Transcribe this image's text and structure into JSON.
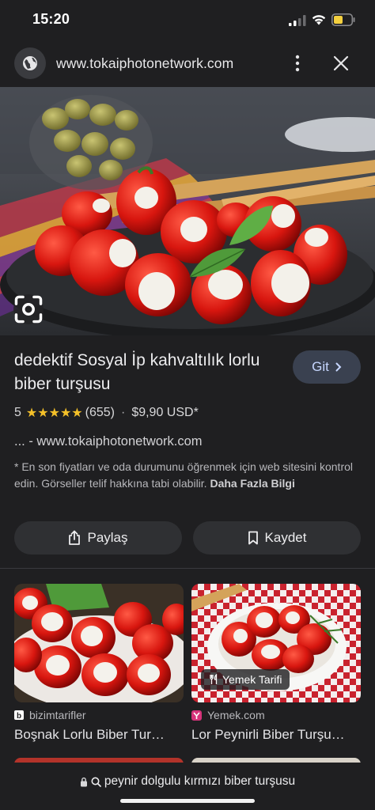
{
  "status_bar": {
    "time": "15:20"
  },
  "url_bar": {
    "url": "www.tokaiphotonetwork.com"
  },
  "product": {
    "title": "dedektif Sosyal İp kahvaltılık lorlu biber turşusu",
    "go_label": "Git",
    "rating": "5",
    "stars": "★★★★★",
    "review_count": "(655)",
    "separator": "·",
    "price": "$9,90 USD*",
    "source": "... - www.tokaiphotonetwork.com",
    "disclaimer": "* En son fiyatları ve oda durumunu öğrenmek için web sitesini kontrol edin. Görseller telif hakkına tabi olabilir.",
    "more_info": "Daha Fazla Bilgi"
  },
  "actions": {
    "share_label": "Paylaş",
    "save_label": "Kaydet"
  },
  "related": [
    {
      "source": "bizimtarifler",
      "title": "Boşnak Lorlu Biber Tur…",
      "badge": ""
    },
    {
      "source": "Yemek.com",
      "title": "Lor Peynirli Biber Turşu…",
      "badge": "Yemek Tarifi"
    }
  ],
  "bottom_bar": {
    "query": "peynir dolgulu kırmızı biber turşusu"
  },
  "colors": {
    "accent_button": "#3a4150",
    "star": "#f4c029",
    "background": "#1f1f21"
  }
}
